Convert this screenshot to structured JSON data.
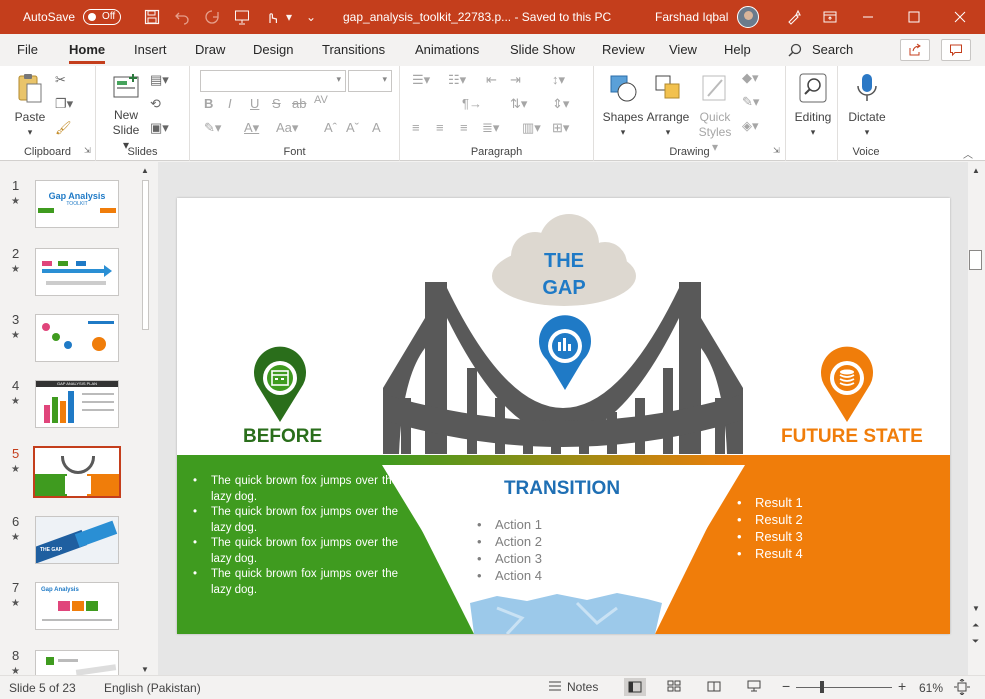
{
  "titlebar": {
    "autosave_label": "AutoSave",
    "autosave_state": "Off",
    "doc_title": "gap_analysis_toolkit_22783.p... - Saved to this PC",
    "user_name": "Farshad Iqbal",
    "accent_color": "#c43e1c"
  },
  "menu": {
    "tabs": [
      "File",
      "Home",
      "Insert",
      "Draw",
      "Design",
      "Transitions",
      "Animations",
      "Slide Show",
      "Review",
      "View",
      "Help"
    ],
    "active_tab": "Home",
    "search_label": "Search"
  },
  "ribbon": {
    "clipboard": {
      "label": "Clipboard",
      "paste": "Paste"
    },
    "slides": {
      "label": "Slides",
      "new_slide_line1": "New",
      "new_slide_line2": "Slide"
    },
    "font": {
      "label": "Font",
      "bold": "B",
      "italic": "I",
      "underline": "U",
      "strike": "S",
      "shadow": "ab",
      "spacing": "AV",
      "case": "Aa",
      "grow": "A",
      "shrink": "A",
      "clear": "A"
    },
    "paragraph": {
      "label": "Paragraph"
    },
    "drawing": {
      "label": "Drawing",
      "shapes": "Shapes",
      "arrange": "Arrange",
      "quick_styles_line1": "Quick",
      "quick_styles_line2": "Styles"
    },
    "editing": {
      "label": "Editing"
    },
    "voice": {
      "label": "Voice",
      "dictate": "Dictate"
    }
  },
  "thumbnails": {
    "items": [
      {
        "num": "1",
        "star": "★"
      },
      {
        "num": "2",
        "star": "★"
      },
      {
        "num": "3",
        "star": "★"
      },
      {
        "num": "4",
        "star": "★"
      },
      {
        "num": "5",
        "star": "★"
      },
      {
        "num": "6",
        "star": "★"
      },
      {
        "num": "7",
        "star": "★"
      },
      {
        "num": "8",
        "star": "★"
      }
    ],
    "active_index": 5,
    "thumb1_title": "Gap Analysis",
    "thumb1_subtitle": "TOOLKIT",
    "thumb4_title": "GAP ANALYSIS PLAN",
    "thumb6_label": "THE GAP",
    "thumb7_title": "Gap Analysis"
  },
  "slide": {
    "gap_line1": "THE",
    "gap_line2": "GAP",
    "before_title": "BEFORE",
    "future_title": "FUTURE STATE",
    "transition_title": "TRANSITION",
    "before_items": [
      "The quick brown fox jumps over the lazy dog.",
      "The quick brown fox jumps over the lazy dog.",
      "The quick brown fox jumps over the lazy dog.",
      "The quick brown fox jumps over the lazy dog."
    ],
    "actions": [
      "Action 1",
      "Action 2",
      "Action 3",
      "Action 4"
    ],
    "results": [
      "Result 1",
      "Result 2",
      "Result 3",
      "Result 4"
    ],
    "colors": {
      "green": "#3f9b1f",
      "dark_green": "#2a6e1b",
      "orange": "#f07d0a",
      "blue": "#1f7ac6",
      "bridge": "#595959",
      "cloud": "#ddd8d0",
      "water": "#9cc9ea"
    }
  },
  "status": {
    "slide_info": "Slide 5 of 23",
    "language": "English (Pakistan)",
    "notes": "Notes",
    "zoom": "61%",
    "minus": "−",
    "plus": "+"
  }
}
